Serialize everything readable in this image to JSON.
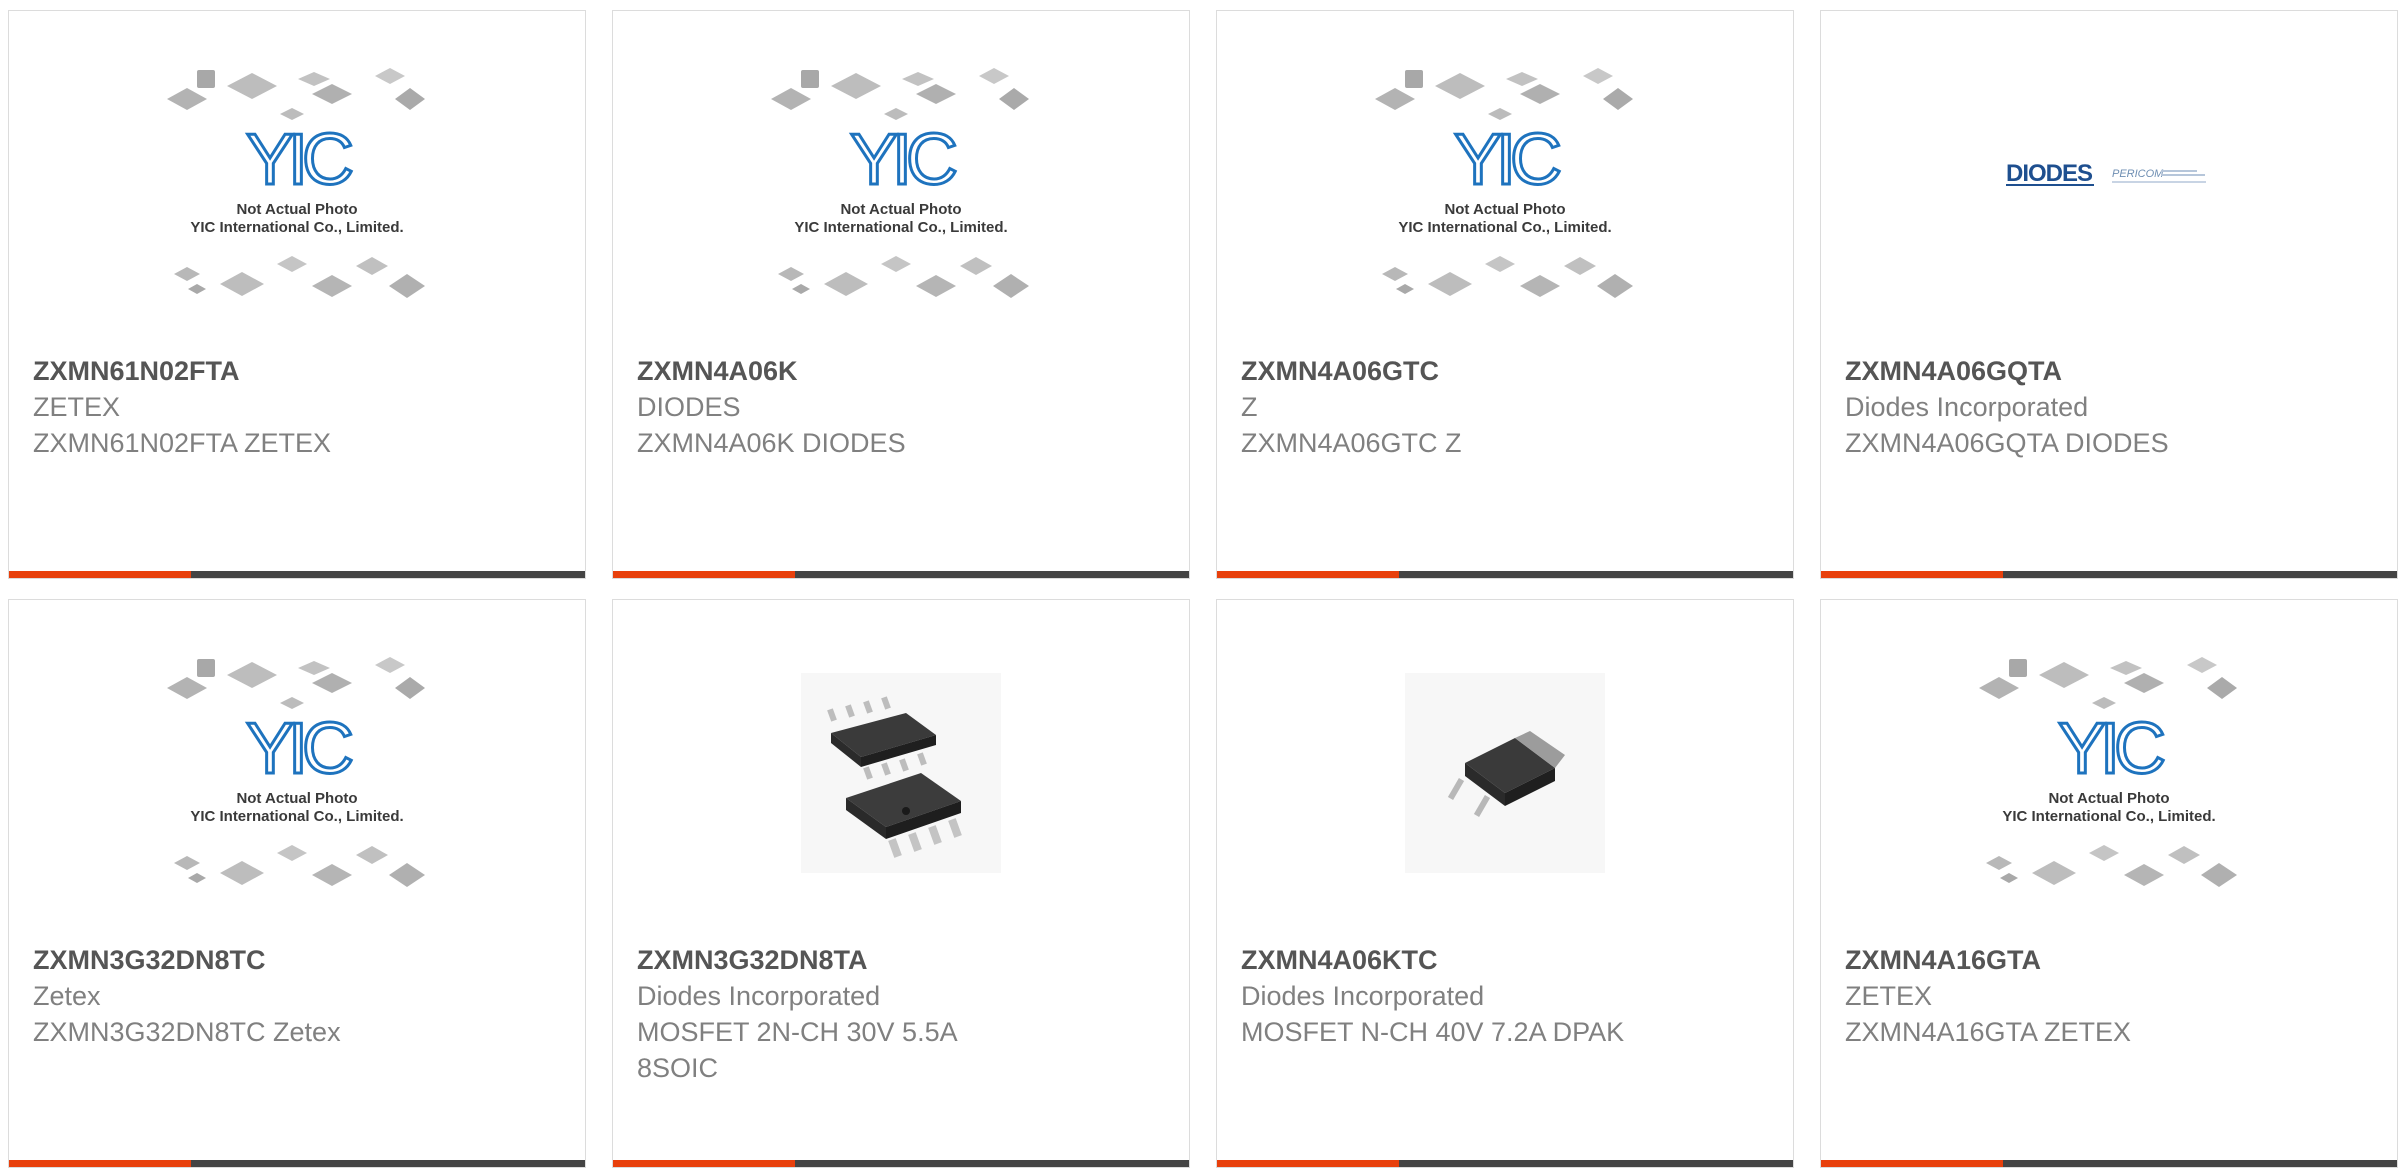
{
  "placeholder": {
    "line1": "Not Actual Photo",
    "line2": "YIC International Co., Limited.",
    "logo": "YIC"
  },
  "diodes_logo": {
    "brand": "DIODES",
    "sub": "PERICOM"
  },
  "colors": {
    "accent": "#e8400c",
    "bar": "#444444",
    "logo_blue": "#1e73be",
    "title": "#555555",
    "text": "#808080"
  },
  "products": [
    {
      "part": "ZXMN61N02FTA",
      "brand": "ZETEX",
      "desc": "ZXMN61N02FTA ZETEX",
      "image": "yic-placeholder-image"
    },
    {
      "part": "ZXMN4A06K",
      "brand": "DIODES",
      "desc": "ZXMN4A06K DIODES",
      "image": "yic-placeholder-image"
    },
    {
      "part": "ZXMN4A06GTC",
      "brand": "Z",
      "desc": "ZXMN4A06GTC Z",
      "image": "yic-placeholder-image"
    },
    {
      "part": "ZXMN4A06GQTA",
      "brand": "Diodes Incorporated",
      "desc": "ZXMN4A06GQTA DIODES",
      "image": "diodes-logo-image"
    },
    {
      "part": "ZXMN3G32DN8TC",
      "brand": "Zetex",
      "desc": "ZXMN3G32DN8TC Zetex",
      "image": "yic-placeholder-image"
    },
    {
      "part": "ZXMN3G32DN8TA",
      "brand": "Diodes Incorporated",
      "desc": "MOSFET 2N-CH 30V 5.5A 8SOIC",
      "image": "soic8-chip-image"
    },
    {
      "part": "ZXMN4A06KTC",
      "brand": "Diodes Incorporated",
      "desc": "MOSFET N-CH 40V 7.2A DPAK",
      "image": "dpak-chip-image"
    },
    {
      "part": "ZXMN4A16GTA",
      "brand": "ZETEX",
      "desc": "ZXMN4A16GTA ZETEX",
      "image": "yic-placeholder-image"
    }
  ]
}
